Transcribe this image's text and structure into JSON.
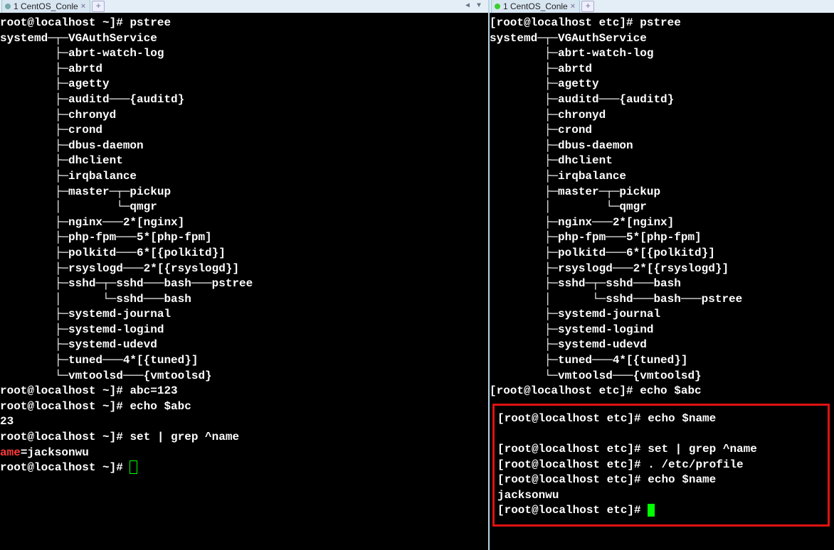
{
  "left": {
    "tab": {
      "title": "1 CentOS_Conle"
    },
    "prompt_home": "root@localhost ~]# ",
    "cmd": {
      "pstree": "pstree",
      "abc": "abc=123",
      "echo_abc": "echo $abc",
      "abc_out": "23",
      "set_name": "set | grep ^name",
      "name_out_pre": "ame",
      "name_out_post": "=jacksonwu"
    },
    "tree": [
      "systemd─┬─VGAuthService",
      "        ├─abrt-watch-log",
      "        ├─abrtd",
      "        ├─agetty",
      "        ├─auditd───{auditd}",
      "        ├─chronyd",
      "        ├─crond",
      "        ├─dbus-daemon",
      "        ├─dhclient",
      "        ├─irqbalance",
      "        ├─master─┬─pickup",
      "        │        └─qmgr",
      "        ├─nginx───2*[nginx]",
      "        ├─php-fpm───5*[php-fpm]",
      "        ├─polkitd───6*[{polkitd}]",
      "        ├─rsyslogd───2*[{rsyslogd}]",
      "        ├─sshd─┬─sshd───bash───pstree",
      "        │      └─sshd───bash",
      "        ├─systemd-journal",
      "        ├─systemd-logind",
      "        ├─systemd-udevd",
      "        ├─tuned───4*[{tuned}]",
      "        └─vmtoolsd───{vmtoolsd}"
    ]
  },
  "right": {
    "tab": {
      "title": "1 CentOS_Conle"
    },
    "prompt_etc": "[root@localhost etc]# ",
    "cmd": {
      "pstree": "pstree",
      "echo_abc": "echo $abc",
      "echo_name1": "echo $name",
      "set_name": "set | grep ^name",
      "src_profile": ". /etc/profile",
      "echo_name2": "echo $name",
      "name_out": "jacksonwu"
    },
    "tree": [
      "systemd─┬─VGAuthService",
      "        ├─abrt-watch-log",
      "        ├─abrtd",
      "        ├─agetty",
      "        ├─auditd───{auditd}",
      "        ├─chronyd",
      "        ├─crond",
      "        ├─dbus-daemon",
      "        ├─dhclient",
      "        ├─irqbalance",
      "        ├─master─┬─pickup",
      "        │        └─qmgr",
      "        ├─nginx───2*[nginx]",
      "        ├─php-fpm───5*[php-fpm]",
      "        ├─polkitd───6*[{polkitd}]",
      "        ├─rsyslogd───2*[{rsyslogd}]",
      "        ├─sshd─┬─sshd───bash",
      "        │      └─sshd───bash───pstree",
      "        ├─systemd-journal",
      "        ├─systemd-logind",
      "        ├─systemd-udevd",
      "        ├─tuned───4*[{tuned}]",
      "        └─vmtoolsd───{vmtoolsd}"
    ]
  }
}
